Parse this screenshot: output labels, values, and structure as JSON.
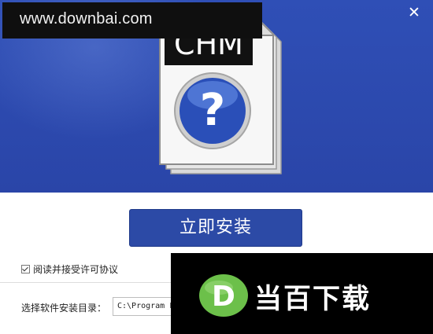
{
  "watermark": {
    "text": "www.downbai.com"
  },
  "window": {
    "close_label": "✕"
  },
  "product": {
    "icon_label": "CHM"
  },
  "install": {
    "button_label": "立即安装"
  },
  "license": {
    "checked": true,
    "label": "阅读并接受许可协议"
  },
  "directory": {
    "label": "选择软件安装目录：",
    "value": "C:\\Program Files"
  },
  "brand": {
    "logo_letter": "D",
    "name": "当百下载"
  },
  "colors": {
    "hero_blue": "#2c4aa6",
    "button_blue": "#2c4aa6",
    "brand_green": "#6cc04a"
  }
}
